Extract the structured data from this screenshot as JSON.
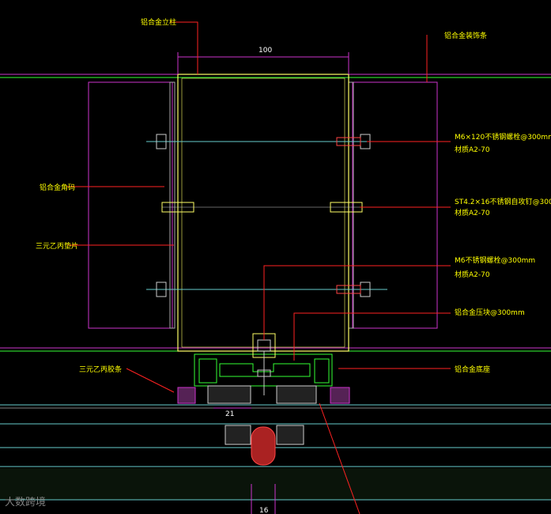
{
  "labels": {
    "top_left": "铝合金立柱",
    "top_right": "铝合金装饰条",
    "left_upper": "铝合金角码",
    "left_mid": "三元乙丙垫片",
    "left_lower": "三元乙丙胶条",
    "right_1a": "M6×120不锈钢螺栓@300mm",
    "right_1b": "材质A2-70",
    "right_2a": "ST4.2×16不锈钢自攻钉@300mm",
    "right_2b": "材质A2-70",
    "right_3a": "M6不锈钢螺栓@300mm",
    "right_3b": "材质A2-70",
    "right_4": "铝合金压块@300mm",
    "right_5": "铝合金底座"
  },
  "dimensions": {
    "top_width": "100",
    "bottom_left": "21",
    "bottom_center": "16"
  },
  "watermark": "大数跨境",
  "colors": {
    "background": "#000000",
    "mullion": "#ffff66",
    "bracket": "#cc33cc",
    "leader": "#ff2222",
    "label": "#ffff00",
    "glass": "#66cccc",
    "bolt": "#cccccc",
    "green": "#33ff33"
  }
}
